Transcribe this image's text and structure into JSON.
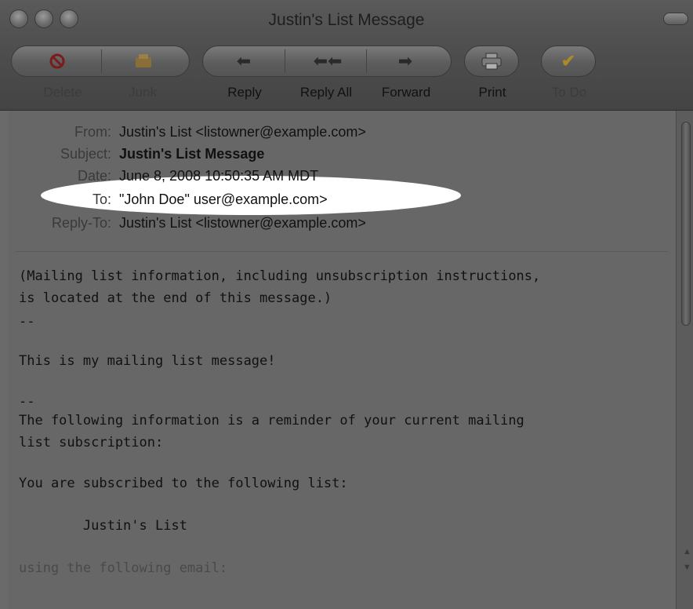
{
  "window": {
    "title": "Justin's List Message"
  },
  "toolbar": {
    "delete": "Delete",
    "junk": "Junk",
    "reply": "Reply",
    "reply_all": "Reply All",
    "forward": "Forward",
    "print": "Print",
    "todo": "To Do"
  },
  "headers": {
    "from_label": "From:",
    "from_value": "Justin's List <listowner@example.com>",
    "subject_label": "Subject:",
    "subject_value": "Justin's List Message",
    "date_label": "Date:",
    "date_value": "June 8, 2008 10:50:35 AM MDT",
    "to_label": "To:",
    "to_value": "\"John Doe\" user@example.com>",
    "replyto_label": "Reply-To:",
    "replyto_value": "Justin's List <listowner@example.com>"
  },
  "body": {
    "l1": "(Mailing list information, including unsubscription instructions,",
    "l2": "is located at the end of this message.)",
    "l3": "--",
    "l4": "This is my mailing list message!",
    "l5": "--",
    "l6": "The following information is a reminder of your current mailing",
    "l7": "list subscription:",
    "l8": "You are subscribed to the following list:",
    "l9": "        Justin's List",
    "l10": "using the following email:"
  },
  "colors": {
    "highlight": "#ffffff",
    "window_bg": "#6a6a6a"
  }
}
